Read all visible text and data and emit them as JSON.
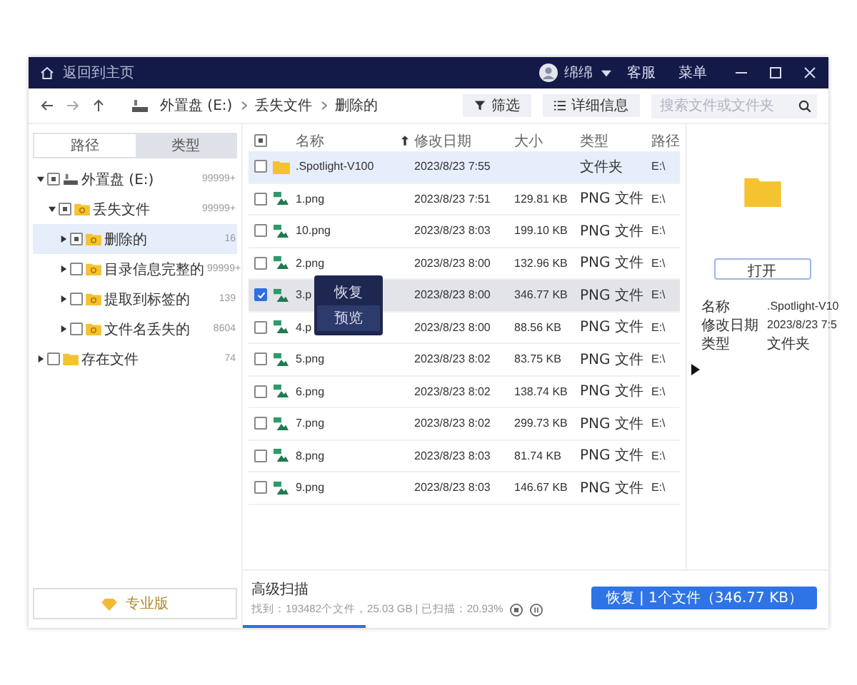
{
  "window": {
    "home_label": "返回到主页",
    "user": "绵绵",
    "links": [
      "客服",
      "菜单"
    ]
  },
  "toolbar": {
    "breadcrumb": [
      "外置盘 (E:)",
      "丢失文件",
      "删除的"
    ],
    "buttons": [
      {
        "label": "筛选",
        "kind": "filter"
      },
      {
        "label": "详细信息",
        "kind": "details"
      }
    ],
    "search": {
      "placeholder": "搜索文件或文件夹"
    }
  },
  "sidebar": {
    "tabs": [
      {
        "label": "路径",
        "selected": true
      },
      {
        "label": "类型",
        "selected": false
      }
    ],
    "tree": [
      {
        "label": "外置盘 (E:)",
        "count": "99999+",
        "kind": "drive",
        "expanded": true,
        "partial": true,
        "selected": false,
        "children": [
          {
            "label": "丢失文件",
            "count": "99999+",
            "kind": "lost",
            "expanded": true,
            "partial": true,
            "selected": false,
            "children": [
              {
                "label": "删除的",
                "count": "16",
                "kind": "lost",
                "expanded": false,
                "partial": true,
                "selected": true
              },
              {
                "label": "目录信息完整的",
                "count": "99999+",
                "kind": "lost",
                "expanded": false,
                "partial": false,
                "selected": false
              },
              {
                "label": "提取到标签的",
                "count": "139",
                "kind": "lost",
                "expanded": false,
                "partial": false,
                "selected": false
              },
              {
                "label": "文件名丢失的",
                "count": "8604",
                "kind": "lost",
                "expanded": false,
                "partial": false,
                "selected": false
              }
            ]
          }
        ]
      },
      {
        "label": "存在文件",
        "count": "74",
        "kind": "folder",
        "expanded": false,
        "partial": false,
        "selected": false
      }
    ],
    "pro_button": "专业版"
  },
  "table": {
    "columns": [
      "名称",
      "修改日期",
      "大小",
      "类型",
      "路径"
    ],
    "header_partial": true,
    "rows": [
      {
        "name": ".Spotlight-V100",
        "date": "2023/8/23 7:55",
        "size": "",
        "type": "文件夹",
        "path": "E:\\",
        "kind": "folder",
        "checked": false,
        "selected": true
      },
      {
        "name": "1.png",
        "date": "2023/8/23 7:51",
        "size": "129.81 KB",
        "type": "PNG 文件",
        "path": "E:\\",
        "kind": "image",
        "checked": false,
        "selected": false
      },
      {
        "name": "10.png",
        "date": "2023/8/23 8:03",
        "size": "199.10 KB",
        "type": "PNG 文件",
        "path": "E:\\",
        "kind": "image",
        "checked": false,
        "selected": false
      },
      {
        "name": "2.png",
        "date": "2023/8/23 8:00",
        "size": "132.96 KB",
        "type": "PNG 文件",
        "path": "E:\\",
        "kind": "image",
        "checked": false,
        "selected": false
      },
      {
        "name": "3.p",
        "date": "2023/8/23 8:00",
        "size": "346.77 KB",
        "type": "PNG 文件",
        "path": "E:\\",
        "kind": "image",
        "checked": true,
        "selected": false
      },
      {
        "name": "4.p",
        "date": "2023/8/23 8:00",
        "size": "88.56 KB",
        "type": "PNG 文件",
        "path": "E:\\",
        "kind": "image",
        "checked": false,
        "selected": false
      },
      {
        "name": "5.png",
        "date": "2023/8/23 8:02",
        "size": "83.75 KB",
        "type": "PNG 文件",
        "path": "E:\\",
        "kind": "image",
        "checked": false,
        "selected": false
      },
      {
        "name": "6.png",
        "date": "2023/8/23 8:02",
        "size": "138.74 KB",
        "type": "PNG 文件",
        "path": "E:\\",
        "kind": "image",
        "checked": false,
        "selected": false
      },
      {
        "name": "7.png",
        "date": "2023/8/23 8:02",
        "size": "299.73 KB",
        "type": "PNG 文件",
        "path": "E:\\",
        "kind": "image",
        "checked": false,
        "selected": false
      },
      {
        "name": "8.png",
        "date": "2023/8/23 8:03",
        "size": "81.74 KB",
        "type": "PNG 文件",
        "path": "E:\\",
        "kind": "image",
        "checked": false,
        "selected": false
      },
      {
        "name": "9.png",
        "date": "2023/8/23 8:03",
        "size": "146.67 KB",
        "type": "PNG 文件",
        "path": "E:\\",
        "kind": "image",
        "checked": false,
        "selected": false
      }
    ]
  },
  "context_menu": [
    {
      "label": "恢复",
      "selected": false
    },
    {
      "label": "预览",
      "selected": true
    }
  ],
  "details": {
    "open_button": "打开",
    "fields": [
      {
        "label": "名称",
        "value": ".Spotlight-V10"
      },
      {
        "label": "修改日期",
        "value": "2023/8/23 7:5"
      },
      {
        "label": "类型",
        "value": "文件夹"
      }
    ]
  },
  "footer": {
    "title": "高级扫描",
    "status": "找到：193482个文件，25.03 GB | 已扫描：20.93%",
    "level": 0.2093,
    "recover_button": "恢复 | 1个文件（346.77 KB）"
  }
}
